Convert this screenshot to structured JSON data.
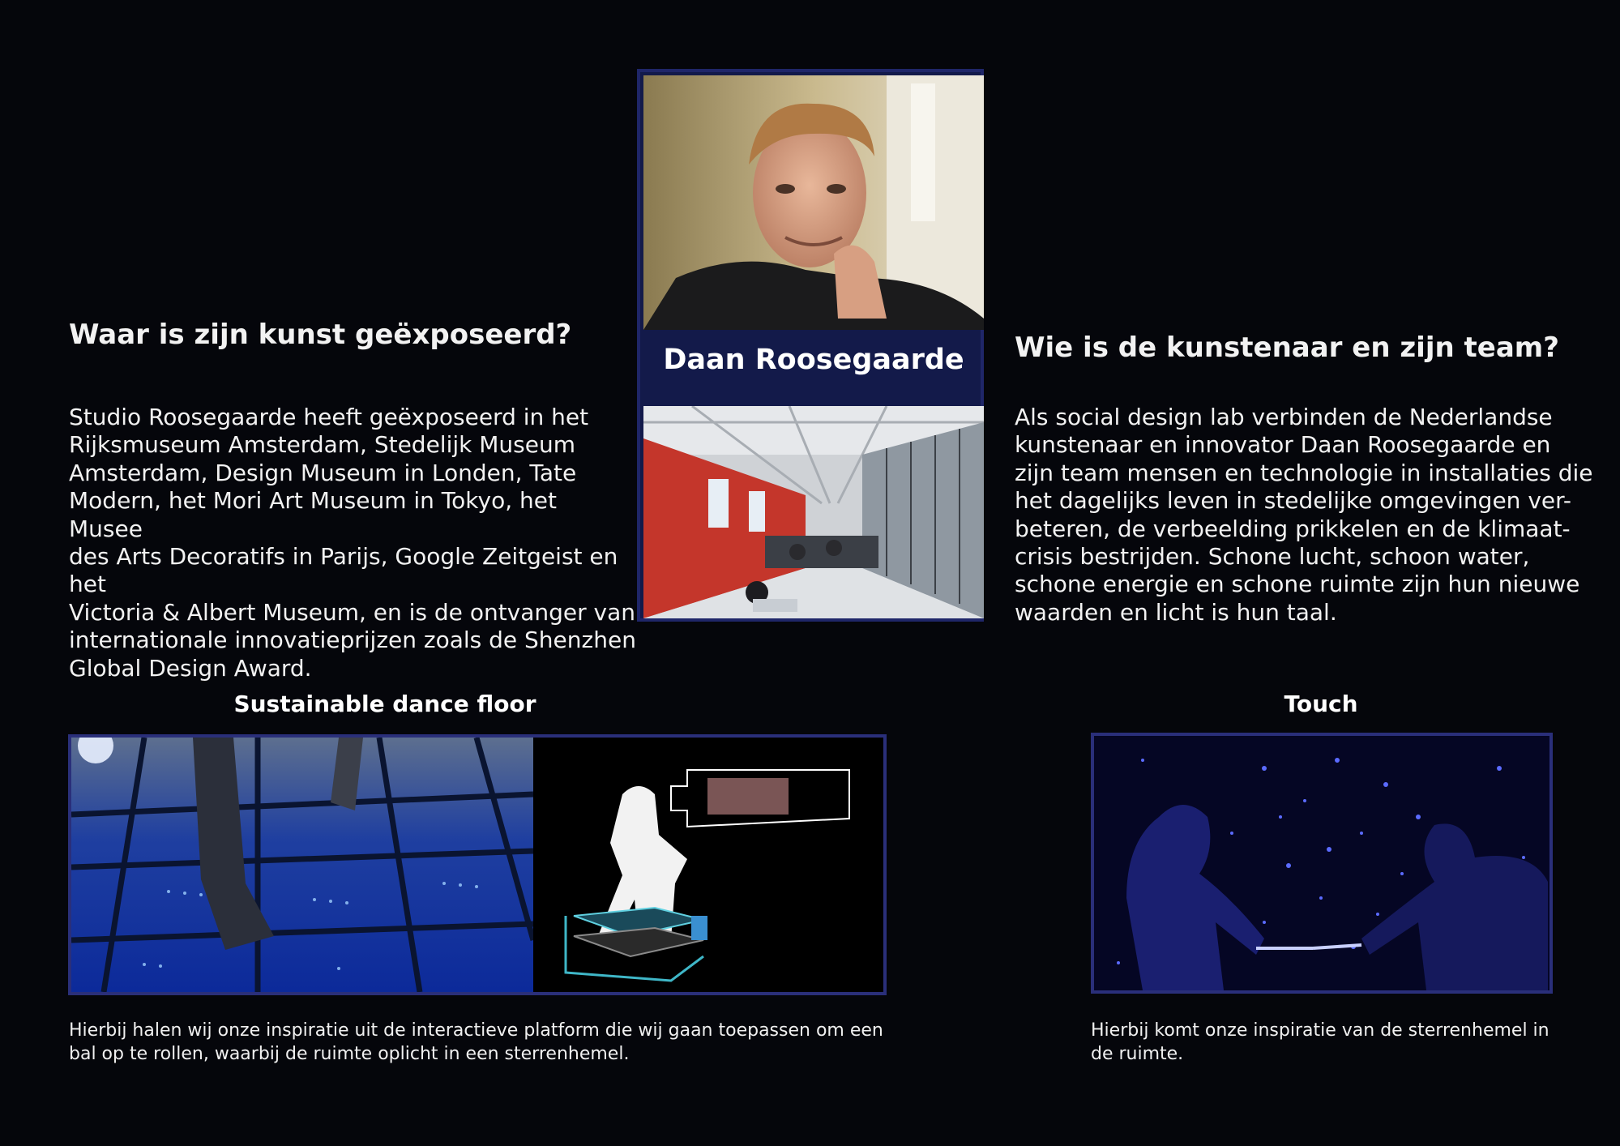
{
  "left": {
    "heading": "Waar is zijn kunst geëxposeerd?",
    "lines": [
      "Studio Roosegaarde heeft geëxposeerd in het",
      "Rijksmuseum Amsterdam, Stedelijk Museum",
      "Amsterdam, Design Museum in Londen, Tate",
      "Modern, het Mori Art Museum in Tokyo, het Musee",
      "des Arts Decoratifs in Parijs, Google Zeitgeist en het",
      "Victoria & Albert Museum, en is de ontvanger van",
      "internationale innovatieprijzen zoals de Shenzhen",
      "Global Design Award."
    ]
  },
  "center": {
    "name": "Daan Roosegaarde"
  },
  "right": {
    "heading": "Wie is de kunstenaar en zijn team?",
    "lines": [
      "Als social design lab verbinden de Nederlandse",
      "kunstenaar en innovator Daan Roosegaarde en",
      "zijn team mensen en technologie in installaties die",
      "het dagelijks leven in stedelijke omgevingen ver-",
      "beteren, de verbeelding prikkelen en de klimaat-",
      "crisis bestrijden. Schone lucht, schoon water,",
      "schone energie en schone ruimte zijn hun nieuwe",
      "waarden en licht is hun taal."
    ]
  },
  "dance": {
    "title": "Sustainable dance floor",
    "caption_lines": [
      "Hierbij halen wij onze inspiratie uit de interactieve platform die wij gaan toepassen om een",
      "bal op te rollen, waarbij de ruimte oplicht in een sterrenhemel."
    ]
  },
  "touch": {
    "title": "Touch",
    "caption_lines": [
      "Hierbij komt onze inspiratie van de sterrenhemel in",
      "de ruimte."
    ]
  },
  "colors": {
    "background": "#05060b",
    "panel": "#131a4a",
    "frame_border": "#2a2f7a"
  }
}
